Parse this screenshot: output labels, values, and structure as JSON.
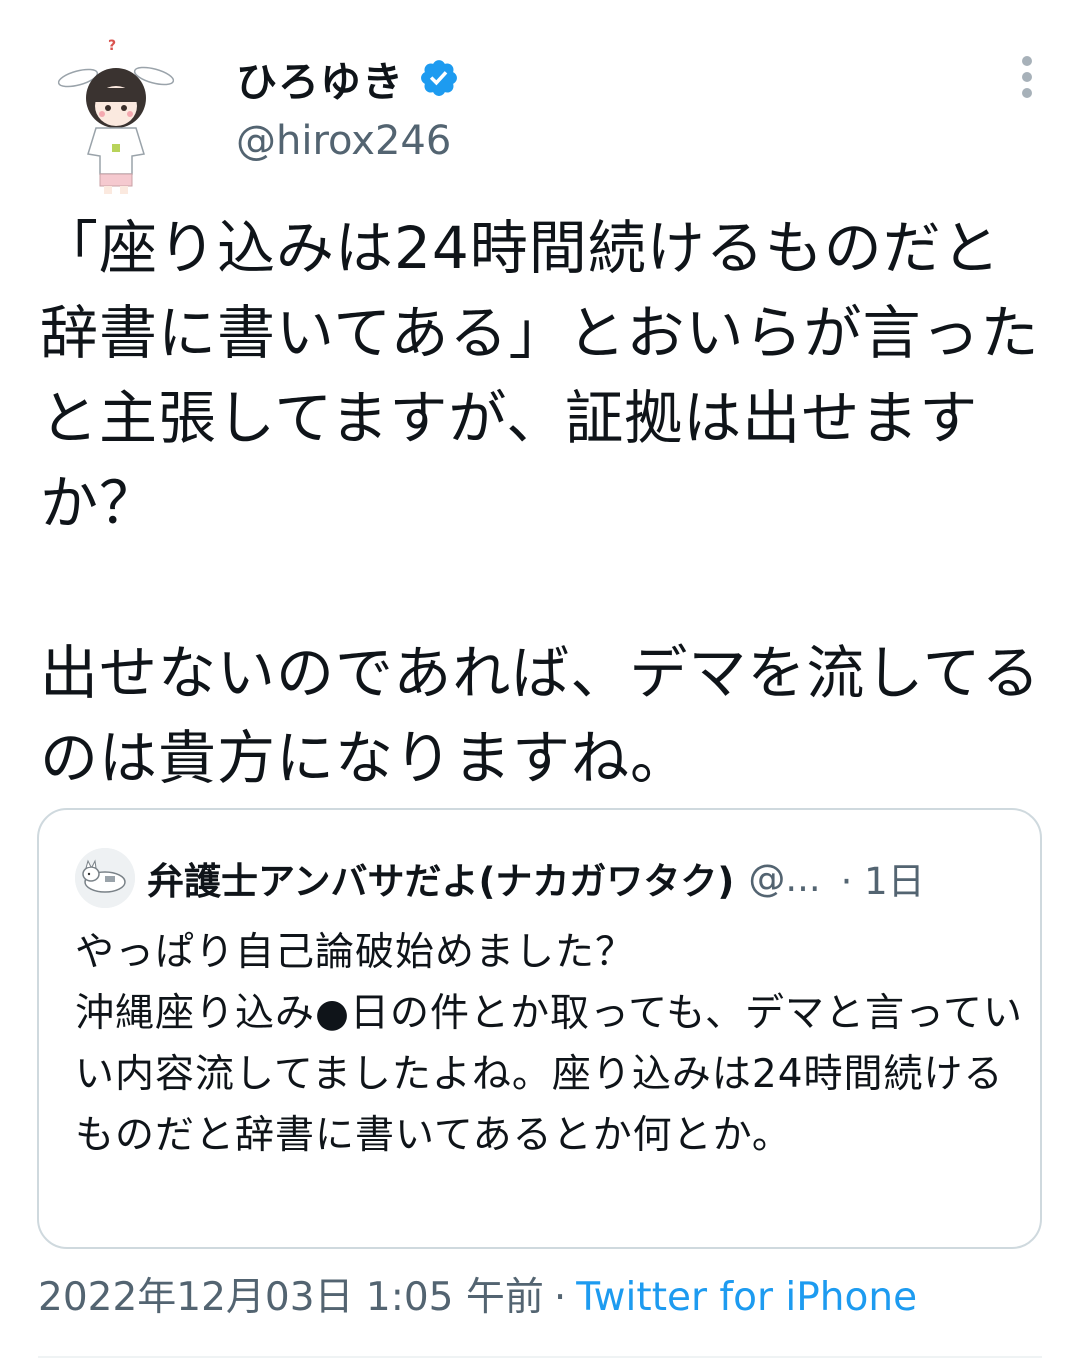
{
  "tweet": {
    "author": {
      "display_name": "ひろゆき",
      "handle": "@hirox246",
      "verified_icon": "verified-badge-icon"
    },
    "text": "「座り込みは24時間続けるものだと辞書に書いてある」とおいらが言ったと主張してますが、証拠は出せますか？\n\n出せないのであれば、デマを流してるのは貴方になりますね。",
    "menu_icon": "more-vertical-icon"
  },
  "quote": {
    "author_name": "弁護士アンバサだよ(ナカガワタク)",
    "handle": "@...",
    "time": "· 1日",
    "text": "やっぱり自己論破始めました？\n沖縄座り込み●日の件とか取っても、デマと言っていい内容流してましたよね。座り込みは24時間続けるものだと辞書に書いてあるとか何とか。"
  },
  "meta": {
    "timestamp": "2022年12月03日 1:05 午前",
    "separator": "·",
    "source": "Twitter for iPhone"
  },
  "colors": {
    "text_primary": "#0f1419",
    "text_secondary": "#536471",
    "link": "#1d9bf0",
    "verified": "#1d9bf0",
    "border": "#cfd9de"
  }
}
